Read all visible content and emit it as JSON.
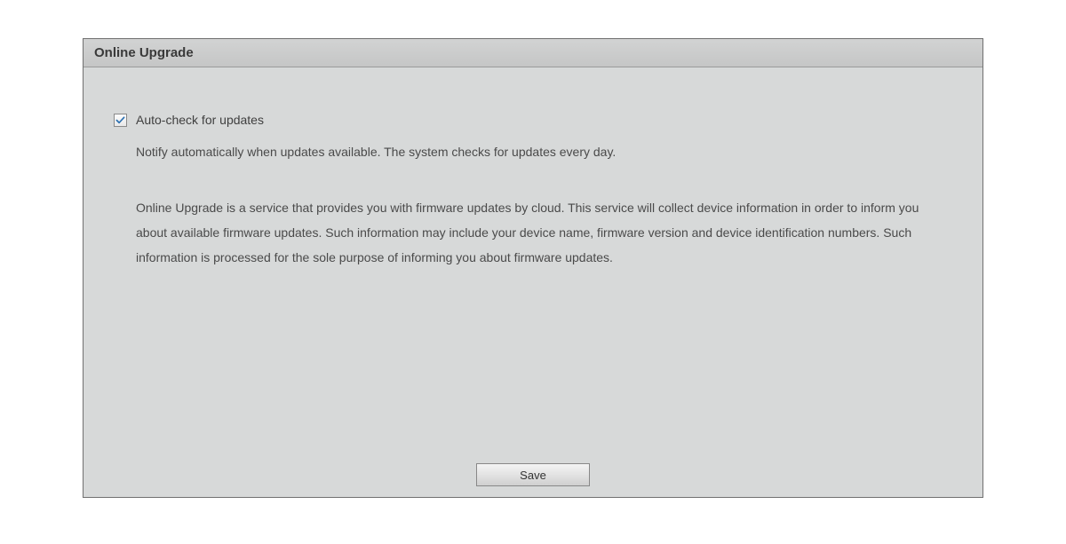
{
  "panel": {
    "title": "Online Upgrade",
    "autoCheck": {
      "checked": true,
      "label": "Auto-check for updates",
      "notify": "Notify automatically when updates available. The system checks for updates every day."
    },
    "description": "Online Upgrade is a service that provides you with firmware updates by cloud. This service will collect device information in order to inform you about available firmware updates. Such information may include your device name, firmware version and device identification numbers. Such information is processed for the sole purpose of informing you about firmware updates.",
    "saveLabel": "Save"
  }
}
